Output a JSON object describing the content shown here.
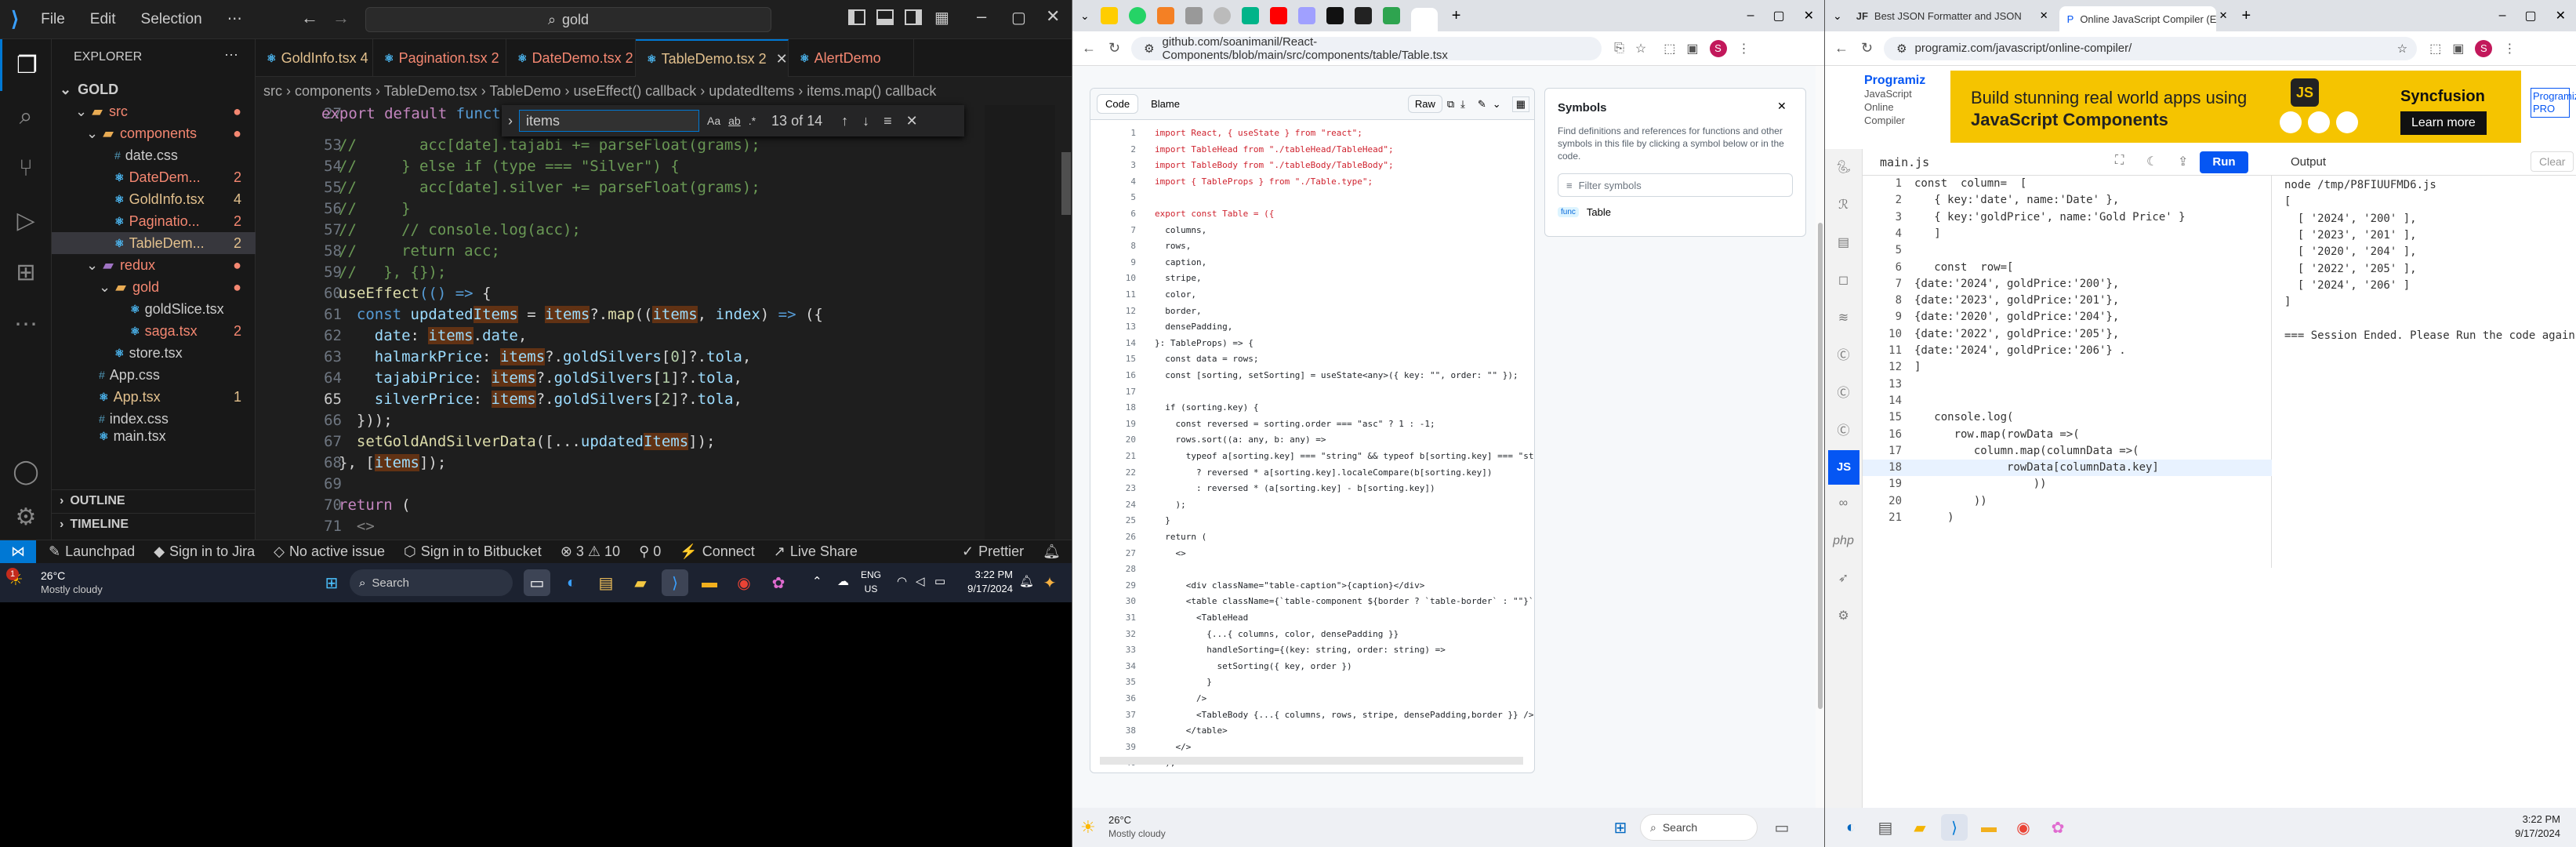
{
  "vscode": {
    "menu": [
      "File",
      "Edit",
      "Selection"
    ],
    "search": "gold",
    "explorer_title": "EXPLORER",
    "root": "GOLD",
    "tree": [
      {
        "label": "src",
        "badge": "",
        "depth": 1
      },
      {
        "label": "components",
        "badge": "",
        "depth": 2
      },
      {
        "label": "date.css",
        "badge": "",
        "depth": 3
      },
      {
        "label": "DateDem...",
        "badge": "2",
        "depth": 3
      },
      {
        "label": "GoldInfo.tsx",
        "badge": "4",
        "depth": 3
      },
      {
        "label": "Paginatio...",
        "badge": "2",
        "depth": 3
      },
      {
        "label": "TableDem...",
        "badge": "2",
        "depth": 3
      },
      {
        "label": "redux",
        "badge": "",
        "depth": 2
      },
      {
        "label": "gold",
        "badge": "",
        "depth": 3
      },
      {
        "label": "goldSlice.tsx",
        "badge": "",
        "depth": 4
      },
      {
        "label": "saga.tsx",
        "badge": "2",
        "depth": 4
      },
      {
        "label": "store.tsx",
        "badge": "",
        "depth": 3
      },
      {
        "label": "App.css",
        "badge": "",
        "depth": 2
      },
      {
        "label": "App.tsx",
        "badge": "1",
        "depth": 2
      },
      {
        "label": "index.css",
        "badge": "",
        "depth": 2
      },
      {
        "label": "main.tsx",
        "badge": "",
        "depth": 2
      }
    ],
    "outline": "OUTLINE",
    "timeline": "TIMELINE",
    "tabs": [
      "GoldInfo.tsx 4",
      "Pagination.tsx 2",
      "DateDemo.tsx 2",
      "TableDemo.tsx 2",
      "AlertDemo"
    ],
    "breadcrumb": "src › components › TableDemo.tsx › TableDemo › useEffect() callback › updatedItems › items.map() callback",
    "find": {
      "term": "items",
      "count": "13 of 14"
    },
    "lines": [
      {
        "n": "27",
        "t": "export default funct"
      },
      {
        "n": "53",
        "t": "//       acc[date].tajabi += parseFloat(grams);"
      },
      {
        "n": "54",
        "t": "//     } else if (type === \"Silver\") {"
      },
      {
        "n": "55",
        "t": "//       acc[date].silver += parseFloat(grams);"
      },
      {
        "n": "56",
        "t": "//     }"
      },
      {
        "n": "57",
        "t": "//     // console.log(acc);"
      },
      {
        "n": "58",
        "t": "//     return acc;"
      },
      {
        "n": "59",
        "t": "//   }, {});"
      },
      {
        "n": "60",
        "t": "useEffect(() => {"
      },
      {
        "n": "61",
        "t": "  const updatedItems = items?.map((items, index) => ({"
      },
      {
        "n": "62",
        "t": "    date: items.date,"
      },
      {
        "n": "63",
        "t": "    halmarkPrice: items?.goldSilvers[0]?.tola,"
      },
      {
        "n": "64",
        "t": "    tajabiPrice: items?.goldSilvers[1]?.tola,"
      },
      {
        "n": "65",
        "t": "    silverPrice: items?.goldSilvers[2]?.tola,"
      },
      {
        "n": "66",
        "t": "  }));"
      },
      {
        "n": "67",
        "t": "  setGoldAndSilverData([...updatedItems]);"
      },
      {
        "n": "68",
        "t": "}, [items]);"
      },
      {
        "n": "69",
        "t": ""
      },
      {
        "n": "70",
        "t": "return ("
      },
      {
        "n": "71",
        "t": "  <>"
      }
    ],
    "status": {
      "launchpad": "Launchpad",
      "jira": "Sign in to Jira",
      "issue": "No active issue",
      "bitbucket": "Sign in to Bitbucket",
      "problems": "⊗ 3 ⚠ 10",
      "ports": "⚲ 0",
      "connect": "Connect",
      "live": "Live Share",
      "prettier": "Prettier"
    }
  },
  "taskbar_left": {
    "temp": "26°C",
    "weather": "Mostly cloudy",
    "search": "Search",
    "lang": "ENG",
    "region": "US",
    "time": "3:22 PM",
    "date": "9/17/2024",
    "notif": "1"
  },
  "github": {
    "url": "github.com/soanimanil/React-Components/blob/main/src/components/table/Table.tsx",
    "tabs": [
      "Code",
      "Blame"
    ],
    "raw": "Raw",
    "symbols_title": "Symbols",
    "symbols_desc": "Find definitions and references for functions and other symbols in this file by clicking a symbol below or in the code.",
    "filter_placeholder": "Filter symbols",
    "symbol_kind": "func",
    "symbol_name": "Table",
    "lines": [
      "import React, { useState } from \"react\";",
      "import TableHead from \"./tableHead/TableHead\";",
      "import TableBody from \"./tableBody/TableBody\";",
      "import { TableProps } from \"./Table.type\";",
      "",
      "export const Table = ({",
      "  columns,",
      "  rows,",
      "  caption,",
      "  stripe,",
      "  color,",
      "  border,",
      "  densePadding,",
      "}: TableProps) => {",
      "  const data = rows;",
      "  const [sorting, setSorting] = useState<any>({ key: \"\", order: \"\" });",
      "",
      "  if (sorting.key) {",
      "    const reversed = sorting.order === \"asc\" ? 1 : -1;",
      "    rows.sort((a: any, b: any) =>",
      "      typeof a[sorting.key] === \"string\" && typeof b[sorting.key] === \"st",
      "        ? reversed * a[sorting.key].localeCompare(b[sorting.key])",
      "        : reversed * (a[sorting.key] - b[sorting.key])",
      "    );",
      "  }",
      "  return (",
      "    <>",
      "",
      "      <div className=\"table-caption\">{caption}</div>",
      "      <table className={`table-component ${border ? `table-border` : \"\"}`",
      "        <TableHead",
      "          {...{ columns, color, densePadding }}",
      "          handleSorting={(key: string, order: string) =>",
      "            setSorting({ key, order })",
      "          }",
      "        />",
      "        <TableBody {...{ columns, rows, stripe, densePadding,border }} />",
      "      </table>",
      "    </>",
      "  );",
      "};"
    ]
  },
  "taskbar_mid": {
    "temp": "26°C",
    "weather": "Mostly cloudy",
    "search": "Search"
  },
  "programiz": {
    "tabs": [
      "Best JSON Formatter and JSON",
      "Online JavaScript Compiler (Ed"
    ],
    "url": "programiz.com/javascript/online-compiler/",
    "logo": "Programiz",
    "sub1": "JavaScript",
    "sub2": "Online",
    "sub3": "Compiler",
    "ad_line1": "Build stunning real world apps using",
    "ad_line2": "JavaScript Components",
    "ad_brand": "Syncfusion",
    "ad_cta": "Learn more",
    "pro": "Programiz PRO",
    "file": "main.js",
    "run": "Run",
    "output_label": "Output",
    "clear": "Clear",
    "lang_badge": "JS",
    "code": [
      "const  column=  [",
      "   { key:'date', name:'Date' },",
      "   { key:'goldPrice', name:'Gold Price' }",
      "   ]",
      "",
      "   const  row=[",
      "{date:'2024', goldPrice:'200'},",
      "{date:'2023', goldPrice:'201'},",
      "{date:'2020', goldPrice:'204'},",
      "{date:'2022', goldPrice:'205'},",
      "{date:'2024', goldPrice:'206'} .",
      "]",
      "",
      "",
      "   console.log(",
      "      row.map(rowData =>(",
      "         column.map(columnData =>(",
      "              rowData[columnData.key]",
      "                  ))",
      "         ))",
      "     )"
    ],
    "output": [
      "node /tmp/P8FIUUFMD6.js",
      "[",
      "  [ '2024', '200' ],",
      "  [ '2023', '201' ],",
      "  [ '2020', '204' ],",
      "  [ '2022', '205' ],",
      "  [ '2024', '206' ]",
      "]",
      "",
      "=== Session Ended. Please Run the code again ==="
    ]
  },
  "taskbar_right": {
    "time": "3:22 PM",
    "date": "9/17/2024"
  }
}
